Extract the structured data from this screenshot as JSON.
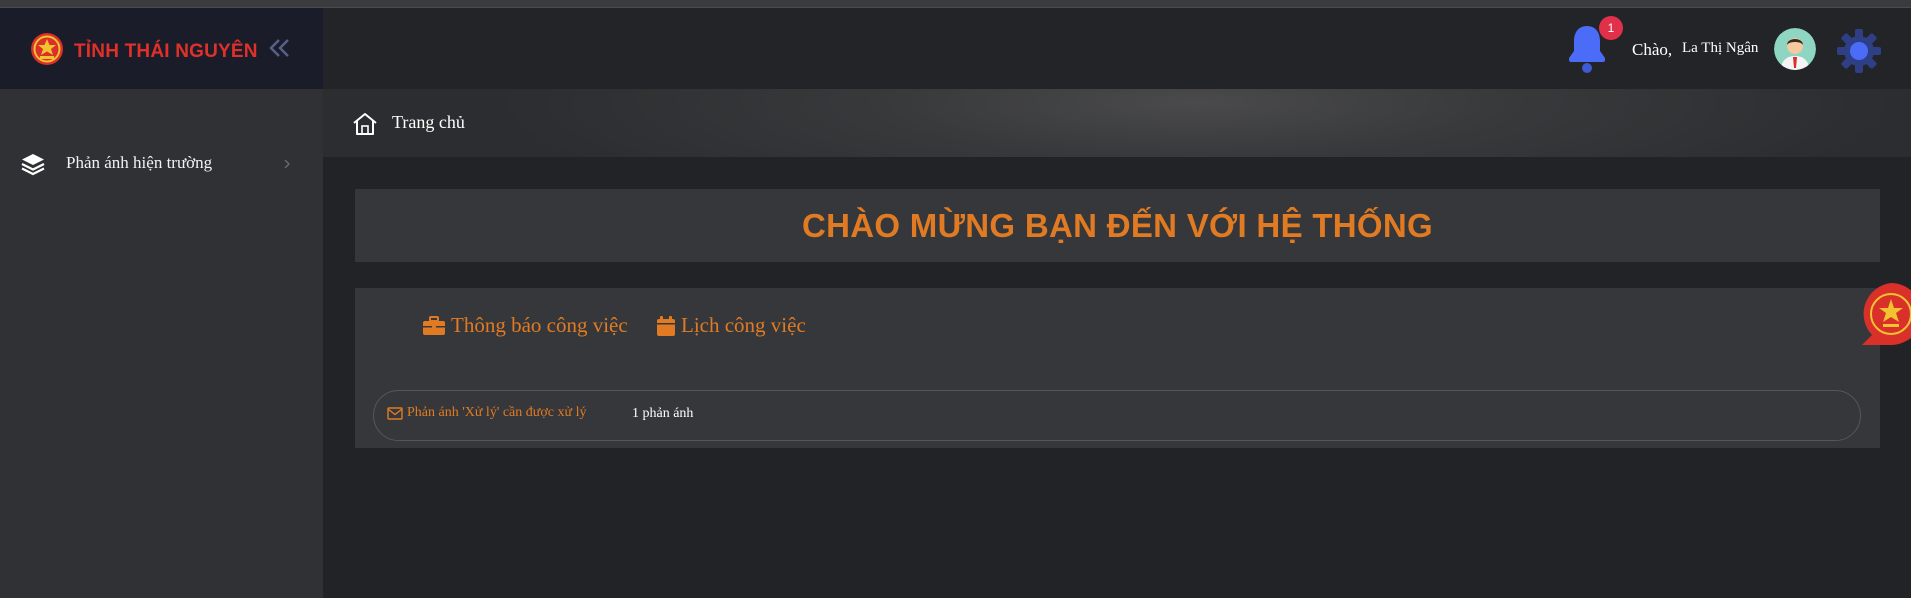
{
  "brand": {
    "name": "TỈNH THÁI NGUYÊN"
  },
  "sidebar": {
    "items": [
      {
        "label": "Phản ánh hiện trường",
        "icon": "layers-icon"
      }
    ]
  },
  "header": {
    "notification_count": "1",
    "greeting": "Chào,",
    "user_name": "La Thị Ngân"
  },
  "breadcrumb": {
    "home_label": "Trang chủ"
  },
  "welcome": {
    "title": "CHÀO MỪNG BẠN ĐẾN VỚI HỆ THỐNG"
  },
  "tabs": [
    {
      "label": "Thông báo công việc",
      "icon": "briefcase-icon"
    },
    {
      "label": "Lịch công việc",
      "icon": "calendar-icon"
    }
  ],
  "notice": {
    "label": "Phản ánh 'Xử lý' cần được xử lý",
    "count": "1 phản ánh"
  },
  "colors": {
    "accent": "#e07b23",
    "brand_red": "#e0302a",
    "bell_blue": "#4a6cf7",
    "badge_red": "#e0304a"
  }
}
